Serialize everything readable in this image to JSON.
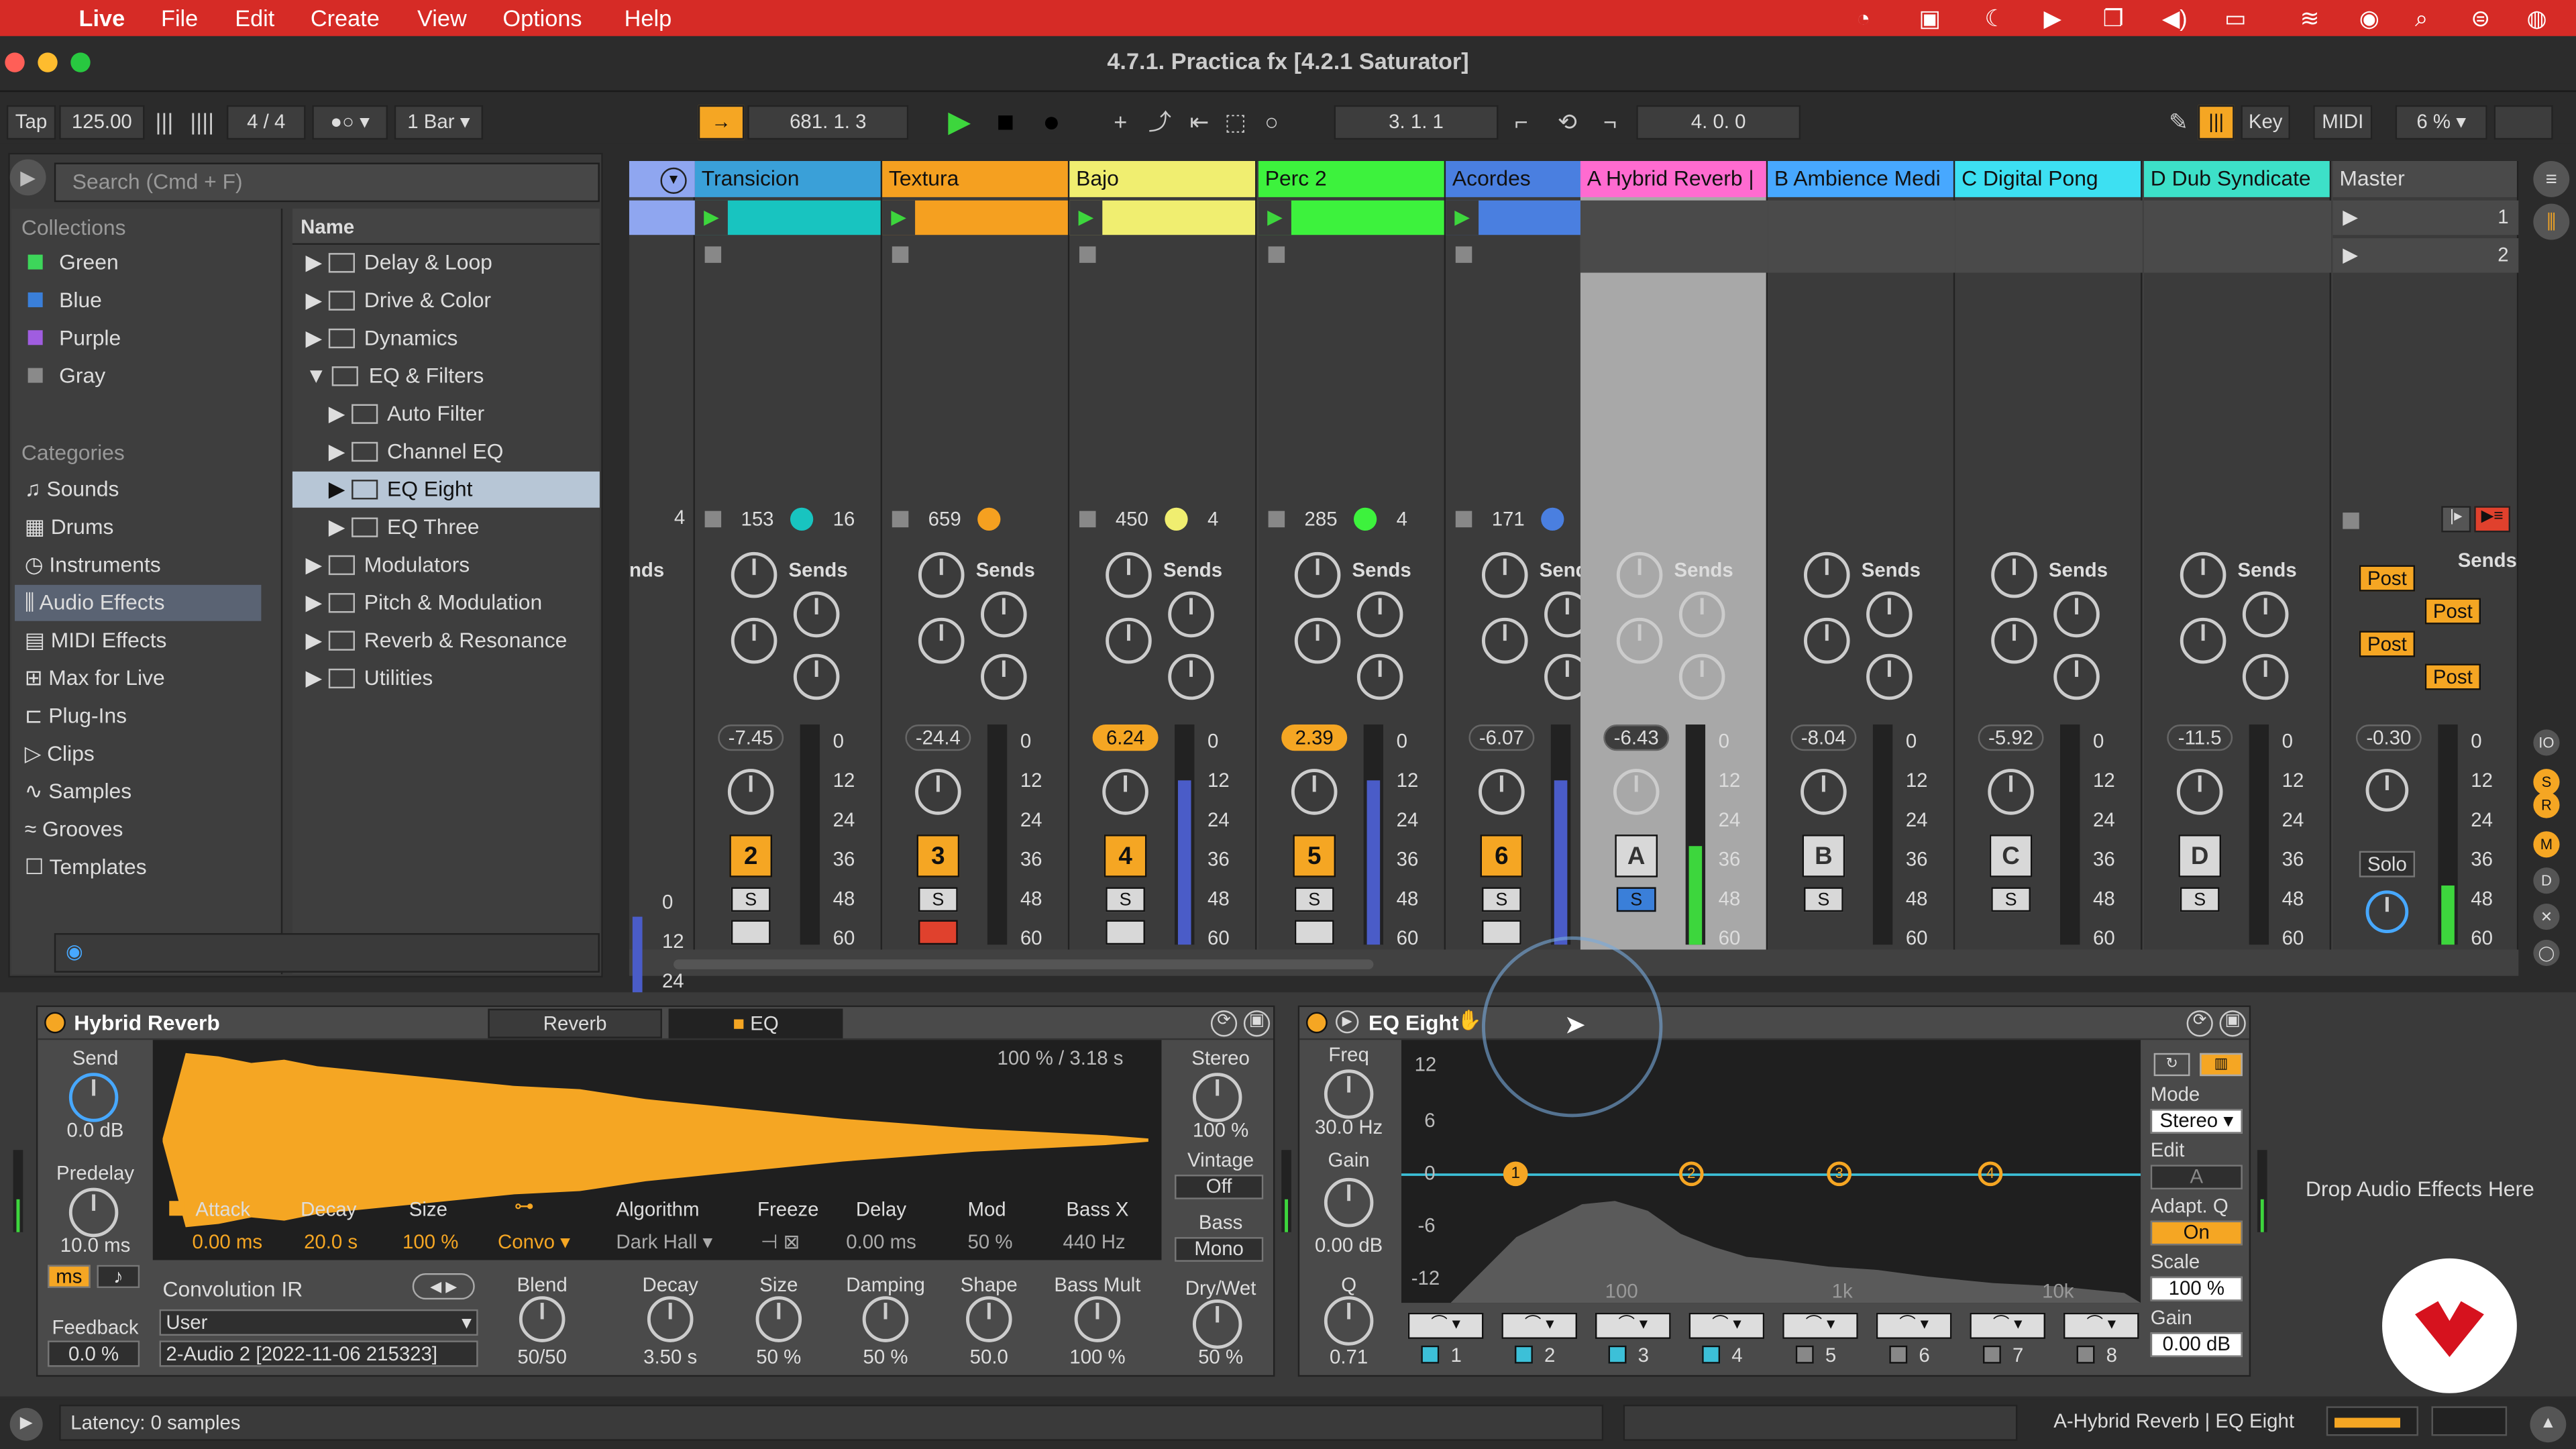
{
  "menubar": {
    "app": "Live",
    "items": [
      "File",
      "Edit",
      "Create",
      "View",
      "Options",
      "Help"
    ]
  },
  "window": {
    "title": "4.7.1. Practica fx  [4.2.1 Saturator]"
  },
  "transport": {
    "tap": "Tap",
    "tempo": "125.00",
    "signature": "4 / 4",
    "quantize": "1 Bar",
    "position": "681.   1.   3",
    "loop_start": "3.   1.   1",
    "loop_length": "4.   0.   0",
    "key": "Key",
    "midi": "MIDI",
    "zoom": "6 %"
  },
  "browser": {
    "search_placeholder": "Search (Cmd + F)",
    "collections_title": "Collections",
    "collections": [
      {
        "label": "Green",
        "color": "#3dd65a"
      },
      {
        "label": "Blue",
        "color": "#3a7fd9"
      },
      {
        "label": "Purple",
        "color": "#a05de0"
      },
      {
        "label": "Gray",
        "color": "#8a8a8a"
      }
    ],
    "categories_title": "Categories",
    "categories": [
      "Sounds",
      "Drums",
      "Instruments",
      "Audio Effects",
      "MIDI Effects",
      "Max for Live",
      "Plug-Ins",
      "Clips",
      "Samples",
      "Grooves",
      "Templates"
    ],
    "name_header": "Name",
    "items": [
      "Delay & Loop",
      "Drive & Color",
      "Dynamics",
      "EQ & Filters",
      "Auto Filter",
      "Channel EQ",
      "EQ Eight",
      "EQ Three",
      "Modulators",
      "Pitch & Modulation",
      "Reverb & Resonance",
      "Utilities"
    ]
  },
  "tracks": [
    {
      "name": "Transicion",
      "color": "#3aa0d8",
      "clipcolor": "#18c4c0",
      "count": "153",
      "sub": "16",
      "volume": "-7.45",
      "number": "2"
    },
    {
      "name": "Textura",
      "color": "#f5a020",
      "clipcolor": "#f5a020",
      "count": "659",
      "sub": "",
      "volume": "-24.4",
      "number": "3"
    },
    {
      "name": "Bajo",
      "color": "#f0ee70",
      "clipcolor": "#f0ee70",
      "count": "450",
      "sub": "4",
      "volume": "6.24",
      "number": "4"
    },
    {
      "name": "Perc 2",
      "color": "#3df23d",
      "clipcolor": "#3df23d",
      "count": "285",
      "sub": "4",
      "volume": "2.39",
      "number": "5"
    },
    {
      "name": "Acordes",
      "color": "#4a7fe0",
      "clipcolor": "#4a7fe0",
      "count": "171",
      "sub": "",
      "volume": "-6.07",
      "number": "6"
    }
  ],
  "returns": [
    {
      "name": "A Hybrid Reverb |",
      "color": "#ff6bd0",
      "volume": "-6.43",
      "letter": "A"
    },
    {
      "name": "B Ambience Medi",
      "color": "#47a8ff",
      "volume": "-8.04",
      "letter": "B"
    },
    {
      "name": "C Digital Pong",
      "color": "#3de0f2",
      "volume": "-5.92",
      "letter": "C"
    },
    {
      "name": "D Dub Syndicate",
      "color": "#3de0c8",
      "volume": "-11.5",
      "letter": "D"
    }
  ],
  "master": {
    "name": "Master",
    "volume": "-0.30",
    "scenes": [
      "1",
      "2"
    ],
    "post": "Post",
    "solo": "Solo"
  },
  "mixer": {
    "sends": "Sends",
    "sends_cut": "nds",
    "sends_cut2": "Sen",
    "left_number": "4",
    "scale": [
      "0",
      "12",
      "24",
      "36",
      "48",
      "60"
    ],
    "knob_labels": [
      "A",
      "B",
      "C",
      "D"
    ],
    "solo": "S"
  },
  "hybrid": {
    "title": "Hybrid Reverb",
    "tab_reverb": "Reverb",
    "tab_eq": "EQ",
    "send_label": "Send",
    "send_value": "0.0 dB",
    "predelay_label": "Predelay",
    "predelay_value": "10.0 ms",
    "ms": "ms",
    "feedback_label": "Feedback",
    "feedback_value": "0.0 %",
    "readout": "100 % / 3.18 s",
    "attack_label": "Attack",
    "attack_value": "0.00 ms",
    "decay_label": "Decay",
    "decay_value": "20.0 s",
    "size_label": "Size",
    "size_value": "100 %",
    "convo": "Convo",
    "algorithm_label": "Algorithm",
    "algorithm_value": "Dark Hall",
    "freeze_label": "Freeze",
    "delay_label": "Delay",
    "delay_value": "0.00 ms",
    "mod_label": "Mod",
    "mod_value": "50 %",
    "bassx_label": "Bass X",
    "bassx_value": "440 Hz",
    "ir_label": "Convolution IR",
    "ir_user": "User",
    "ir_file": "2-Audio 2 [2022-11-06 215323]",
    "knobs": [
      {
        "label": "Blend",
        "value": "50/50"
      },
      {
        "label": "Decay",
        "value": "3.50 s"
      },
      {
        "label": "Size",
        "value": "50 %"
      },
      {
        "label": "Damping",
        "value": "50 %"
      },
      {
        "label": "Shape",
        "value": "50.0"
      },
      {
        "label": "Bass Mult",
        "value": "100 %"
      }
    ],
    "stereo_label": "Stereo",
    "stereo_value": "100 %",
    "vintage_label": "Vintage",
    "vintage_value": "Off",
    "bass_label": "Bass",
    "bass_value": "Mono",
    "drywet_label": "Dry/Wet",
    "drywet_value": "50 %"
  },
  "eq": {
    "title": "EQ Eight",
    "freq_label": "Freq",
    "freq_value": "30.0 Hz",
    "gain_label": "Gain",
    "gain_value": "0.00 dB",
    "q_label": "Q",
    "q_value": "0.71",
    "db_ticks": [
      "12",
      "6",
      "0",
      "-6",
      "-12"
    ],
    "freq_ticks": [
      "100",
      "1k",
      "10k"
    ],
    "bands": [
      "1",
      "2",
      "3",
      "4",
      "5",
      "6",
      "7",
      "8"
    ],
    "mode_label": "Mode",
    "mode_value": "Stereo",
    "edit_label": "Edit",
    "edit_value": "A",
    "adaptq_label": "Adapt. Q",
    "adaptq_value": "On",
    "scale_label": "Scale",
    "scale_value": "100 %",
    "gain2_label": "Gain",
    "gain2_value": "0.00 dB"
  },
  "dropzone": "Drop Audio Effects Here",
  "status": {
    "latency": "Latency: 0 samples",
    "selection": "A-Hybrid Reverb | EQ Eight"
  }
}
